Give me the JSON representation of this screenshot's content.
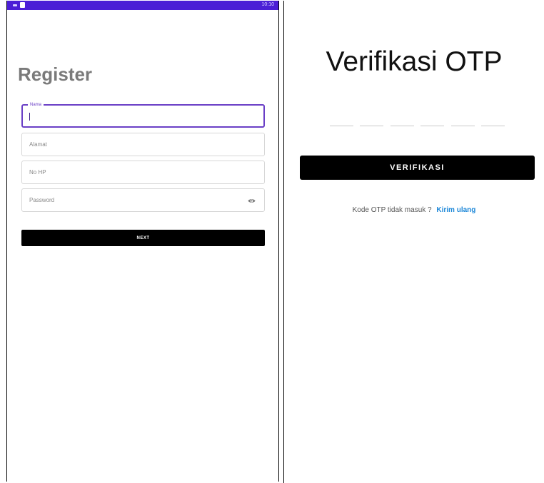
{
  "left_screen": {
    "status_bar": {
      "time": "10:10",
      "color": "#4b1fd6"
    },
    "title": "Register",
    "fields": {
      "name": {
        "label": "Nama",
        "value": ""
      },
      "alamat": {
        "placeholder": "Alamat"
      },
      "nohp": {
        "placeholder": "No HP"
      },
      "password": {
        "placeholder": "Password"
      }
    },
    "next_label": "NEXT"
  },
  "right_screen": {
    "title": "Verifikasi OTP",
    "otp_slots": [
      "",
      "",
      "",
      "",
      "",
      ""
    ],
    "verify_label": "VERIFIKASI",
    "resend_text": "Kode OTP tidak masuk ?",
    "resend_link": "Kirim ulang",
    "link_color": "#1e88d8"
  }
}
